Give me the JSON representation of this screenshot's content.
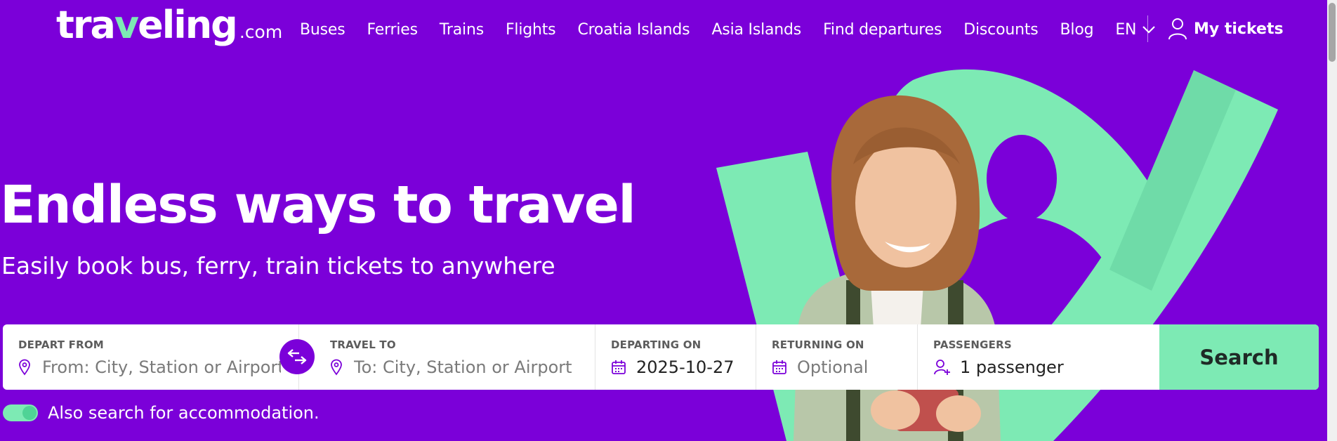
{
  "brand": {
    "logo_part1": "tra",
    "logo_part2": "v",
    "logo_part3": "eling",
    "logo_suffix": ".com",
    "accent_color": "#7deab4",
    "background_color": "#7b00d9"
  },
  "nav": {
    "items": [
      {
        "label": "Buses"
      },
      {
        "label": "Ferries"
      },
      {
        "label": "Trains"
      },
      {
        "label": "Flights"
      },
      {
        "label": "Croatia Islands"
      },
      {
        "label": "Asia Islands"
      },
      {
        "label": "Find departures"
      },
      {
        "label": "Discounts"
      },
      {
        "label": "Blog"
      }
    ],
    "language": "EN",
    "language_icon": "chevron-down-icon",
    "my_tickets": "My tickets",
    "my_tickets_icon": "user-icon"
  },
  "hero": {
    "title": "Endless ways to travel",
    "subtitle": "Easily book bus, ferry, train tickets to anywhere"
  },
  "search": {
    "depart": {
      "label": "DEPART FROM",
      "placeholder": "From: City, Station or Airport",
      "icon": "location-pin-icon"
    },
    "swap_icon": "swap-arrows-icon",
    "arrive": {
      "label": "TRAVEL TO",
      "placeholder": "To: City, Station or Airport",
      "icon": "location-pin-icon"
    },
    "departing": {
      "label": "DEPARTING ON",
      "value": "2025-10-27",
      "icon": "calendar-icon"
    },
    "returning": {
      "label": "RETURNING ON",
      "placeholder": "Optional",
      "icon": "calendar-icon"
    },
    "passengers": {
      "label": "PASSENGERS",
      "value": "1 passenger",
      "icon": "add-user-icon"
    },
    "button": "Search"
  },
  "accommodation": {
    "label": "Also search for accommodation.",
    "enabled": true
  }
}
